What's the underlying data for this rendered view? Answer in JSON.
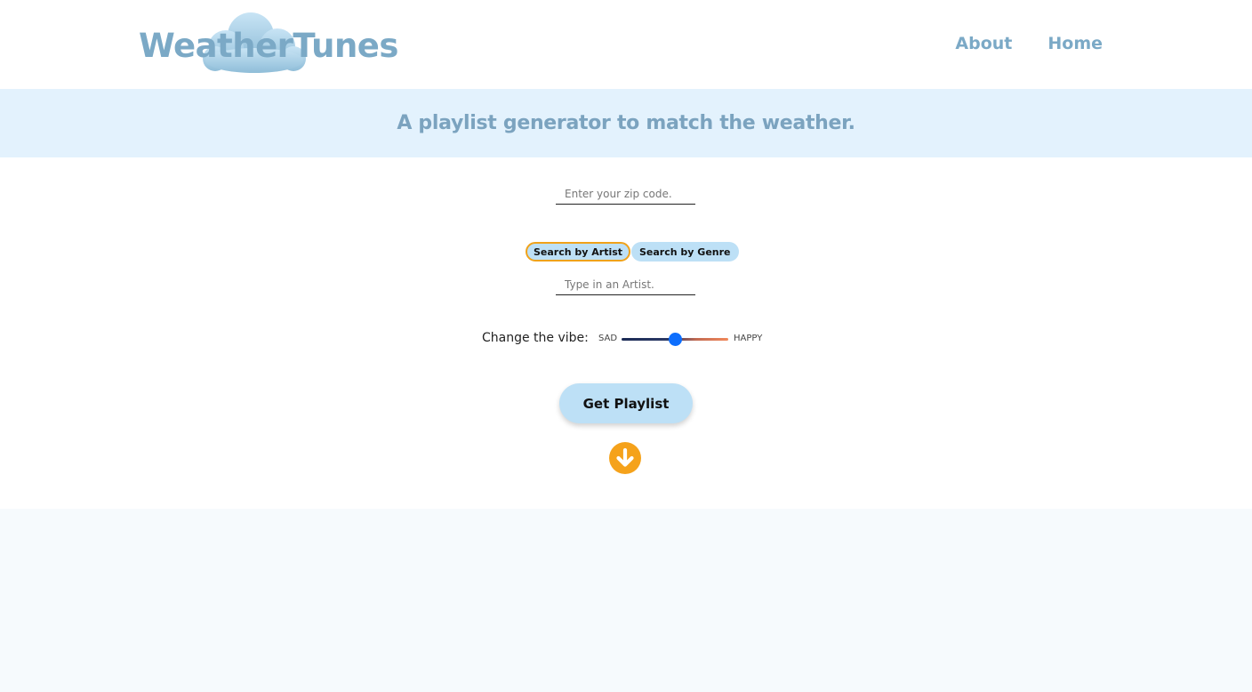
{
  "header": {
    "logo_text": "WeatherTunes",
    "nav": [
      {
        "label": "About"
      },
      {
        "label": "Home"
      }
    ]
  },
  "banner": {
    "tagline": "A playlist generator to match the weather."
  },
  "form": {
    "zip_placeholder": "Enter your zip code.",
    "zip_value": "",
    "search_modes": [
      {
        "label": "Search by Artist",
        "active": true
      },
      {
        "label": "Search by Genre",
        "active": false
      }
    ],
    "artist_placeholder": "Type in an Artist.",
    "artist_value": "",
    "vibe": {
      "label": "Change the vibe:",
      "min_label": "SAD",
      "max_label": "HAPPY",
      "value_fraction": 0.5
    },
    "submit_label": "Get Playlist",
    "scroll_icon": "arrow-down-circle-icon"
  },
  "colors": {
    "brand": "#7ba9c6",
    "banner_bg": "#e3f2fd",
    "button_bg": "#bde0f6",
    "accent_orange": "#f5a21b",
    "slider_thumb": "#0d6efd"
  }
}
